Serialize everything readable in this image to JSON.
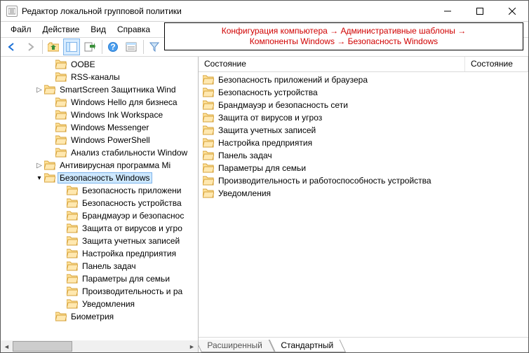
{
  "window": {
    "title": "Редактор локальной групповой политики"
  },
  "menu": {
    "file": "Файл",
    "action": "Действие",
    "view": "Вид",
    "help": "Справка"
  },
  "breadcrumb": "Конфигурация компьютера → Административные шаблоны →\nКомпоненты Windows → Безопасность Windows",
  "tree": {
    "items": [
      {
        "indent": 4,
        "exp": "",
        "label": "OOBE"
      },
      {
        "indent": 4,
        "exp": "",
        "label": "RSS-каналы"
      },
      {
        "indent": 3,
        "exp": ">",
        "label": "SmartScreen Защитника Wind"
      },
      {
        "indent": 4,
        "exp": "",
        "label": "Windows Hello для бизнеса"
      },
      {
        "indent": 4,
        "exp": "",
        "label": "Windows Ink Workspace"
      },
      {
        "indent": 4,
        "exp": "",
        "label": "Windows Messenger"
      },
      {
        "indent": 4,
        "exp": "",
        "label": "Windows PowerShell"
      },
      {
        "indent": 4,
        "exp": "",
        "label": "Анализ стабильности Window"
      },
      {
        "indent": 3,
        "exp": ">",
        "label": "Антивирусная программа Mi"
      },
      {
        "indent": 3,
        "exp": "v",
        "label": "Безопасность Windows",
        "selected": true
      },
      {
        "indent": 5,
        "exp": "",
        "label": "Безопасность приложени"
      },
      {
        "indent": 5,
        "exp": "",
        "label": "Безопасность устройства"
      },
      {
        "indent": 5,
        "exp": "",
        "label": "Брандмауэр и безопаснос"
      },
      {
        "indent": 5,
        "exp": "",
        "label": "Защита от вирусов и угро"
      },
      {
        "indent": 5,
        "exp": "",
        "label": "Защита учетных записей"
      },
      {
        "indent": 5,
        "exp": "",
        "label": "Настройка предприятия"
      },
      {
        "indent": 5,
        "exp": "",
        "label": "Панель задач"
      },
      {
        "indent": 5,
        "exp": "",
        "label": "Параметры для семьи"
      },
      {
        "indent": 5,
        "exp": "",
        "label": "Производительность и ра"
      },
      {
        "indent": 5,
        "exp": "",
        "label": "Уведомления"
      },
      {
        "indent": 4,
        "exp": "",
        "label": "Биометрия"
      }
    ]
  },
  "columns": {
    "state1": "Состояние",
    "state2": "Состояние"
  },
  "list": {
    "items": [
      "Безопасность приложений и браузера",
      "Безопасность устройства",
      "Брандмауэр и безопасность сети",
      "Защита от вирусов и угроз",
      "Защита учетных записей",
      "Настройка предприятия",
      "Панель задач",
      "Параметры для семьи",
      "Производительность и работоспособность устройства",
      "Уведомления"
    ]
  },
  "tabs": {
    "extended": "Расширенный",
    "standard": "Стандартный"
  }
}
